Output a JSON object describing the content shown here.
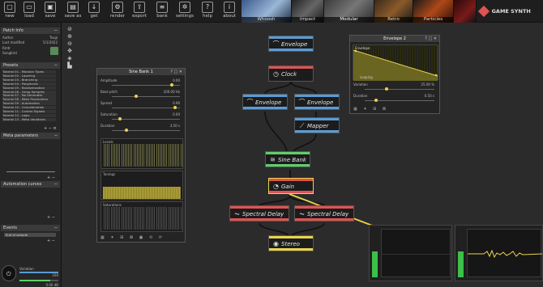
{
  "toolbar": {
    "buttons": [
      {
        "label": "new",
        "icon": "new-file-icon"
      },
      {
        "label": "load",
        "icon": "folder-icon"
      },
      {
        "label": "save",
        "icon": "save-icon"
      },
      {
        "label": "save as",
        "icon": "save-as-icon"
      },
      {
        "label": "get",
        "icon": "download-icon"
      },
      {
        "label": "render",
        "icon": "render-icon"
      },
      {
        "label": "export",
        "icon": "export-icon"
      },
      {
        "label": "bank",
        "icon": "bank-icon"
      },
      {
        "label": "settings",
        "icon": "gear-icon"
      },
      {
        "label": "help",
        "icon": "help-icon"
      },
      {
        "label": "about",
        "icon": "info-icon"
      }
    ],
    "thumbnails": [
      "Whoosh",
      "Impact",
      "Modular",
      "Retro",
      "Particles"
    ],
    "brand": "GAME SYNTH"
  },
  "left": {
    "patch_info": {
      "title": "Patch Info",
      "rows": [
        {
          "k": "Author",
          "v": "Tsugi"
        },
        {
          "k": "Last modified",
          "v": "5/1/2022"
        },
        {
          "k": "Rmtr",
          "v": ""
        },
        {
          "k": "Songbird",
          "v": ""
        }
      ]
    },
    "presets_title": "Presets",
    "presets": [
      "Tutorial 01 - Modular Types",
      "Tutorial 02 - Layering",
      "Tutorial 03 - Branching",
      "Tutorial 04 - Polyphonic",
      "Tutorial 05 - Randomization",
      "Tutorial 06 - Using Samples",
      "Tutorial 07 - No Generator",
      "Tutorial 08 - Meta Parameters",
      "Tutorial 09 - Automation",
      "Tutorial 10 - Concatenation",
      "Tutorial 11 - Control Signals",
      "Tutorial 12 - Logic",
      "Tutorial 13 - Meta Variations"
    ],
    "meta_title": "Meta parameters",
    "automation_title": "Automation curves",
    "events_title": "Events",
    "events_item": "End of sample",
    "variation_label": "Variation",
    "variation_value": "100",
    "output_value": "0.00 dB"
  },
  "nodes": [
    {
      "name": "Envelope",
      "icon": "envelope-icon"
    },
    {
      "name": "Clock",
      "icon": "clock-icon"
    },
    {
      "name": "Envelope",
      "icon": "envelope-icon"
    },
    {
      "name": "Envelope",
      "icon": "envelope-icon"
    },
    {
      "name": "Mapper",
      "icon": "mapper-icon"
    },
    {
      "name": "Sine Bank",
      "icon": "sine-bank-icon"
    },
    {
      "name": "Gain",
      "icon": "gain-icon"
    },
    {
      "name": "Spectral Delay",
      "icon": "spectral-delay-icon"
    },
    {
      "name": "Spectral Delay",
      "icon": "spectral-delay-icon"
    },
    {
      "name": "Stereo",
      "icon": "stereo-icon"
    }
  ],
  "sine_bank": {
    "title": "Sine Bank 1",
    "params": [
      {
        "k": "Amplitude",
        "v": "0.00",
        "level": 0.9
      },
      {
        "k": "Base pitch",
        "v": "100.00 Hz",
        "level": 0.35
      },
      {
        "k": "Spread",
        "v": "0.96",
        "level": 0.95
      },
      {
        "k": "Saturation",
        "v": "0.00",
        "level": 0.1
      },
      {
        "k": "Duration",
        "v": "3.50 s",
        "level": 0.2
      }
    ],
    "graphs": [
      "Levels",
      "Tunings",
      "Saturations"
    ]
  },
  "envelope2": {
    "title": "Envelope 2",
    "graph_label": "Envelope",
    "looping": "Looping",
    "params": [
      {
        "k": "Variation",
        "v": "25.00 %",
        "level": 0.3
      },
      {
        "k": "Duration",
        "v": "0.50 s",
        "level": 0.15
      }
    ]
  },
  "colors": {
    "accent": "#e9d44c",
    "blue": "#5b9bd5",
    "red": "#e05353",
    "green": "#5fcf6b",
    "meter": "#3cc04a"
  }
}
